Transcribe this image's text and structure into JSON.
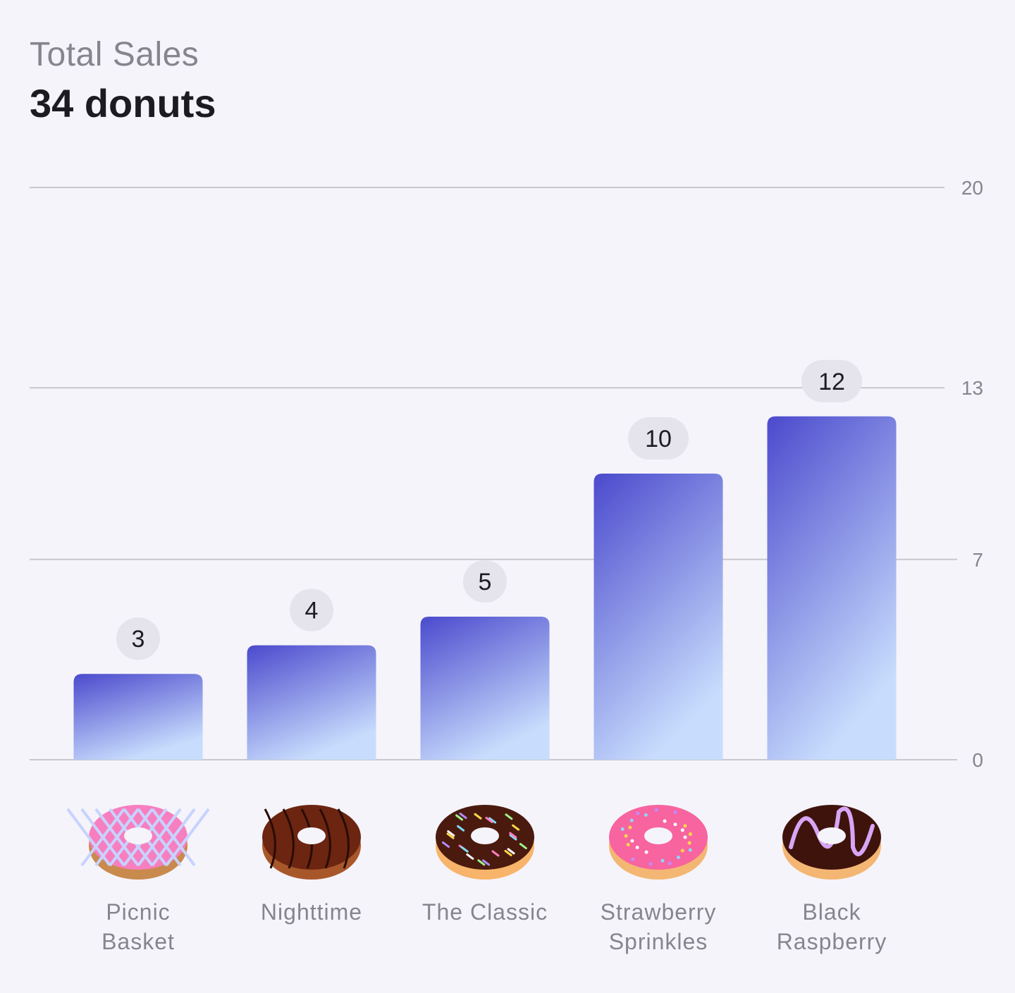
{
  "header": {
    "subtitle": "Total Sales",
    "title": "34 donuts"
  },
  "colors": {
    "background": "#f5f4fa",
    "bar_top": "#4b4acd",
    "bar_bottom": "#c8ddfd",
    "gridline": "#c9c8ce",
    "value_badge": "#e5e3ec"
  },
  "chart_data": {
    "type": "bar",
    "categories": [
      [
        "Picnic",
        "Basket"
      ],
      [
        "Nighttime"
      ],
      [
        "The Classic"
      ],
      [
        "Strawberry",
        "Sprinkles"
      ],
      [
        "Black",
        "Raspberry"
      ]
    ],
    "values": [
      3,
      4,
      5,
      10,
      12
    ],
    "icons": [
      "donut-picnic-basket-icon",
      "donut-nighttime-icon",
      "donut-the-classic-icon",
      "donut-strawberry-sprinkles-icon",
      "donut-black-raspberry-icon"
    ],
    "yticks": [
      0,
      7,
      13,
      20
    ],
    "ylim": [
      0,
      20
    ],
    "grid": true,
    "xlabel": "",
    "ylabel": ""
  }
}
